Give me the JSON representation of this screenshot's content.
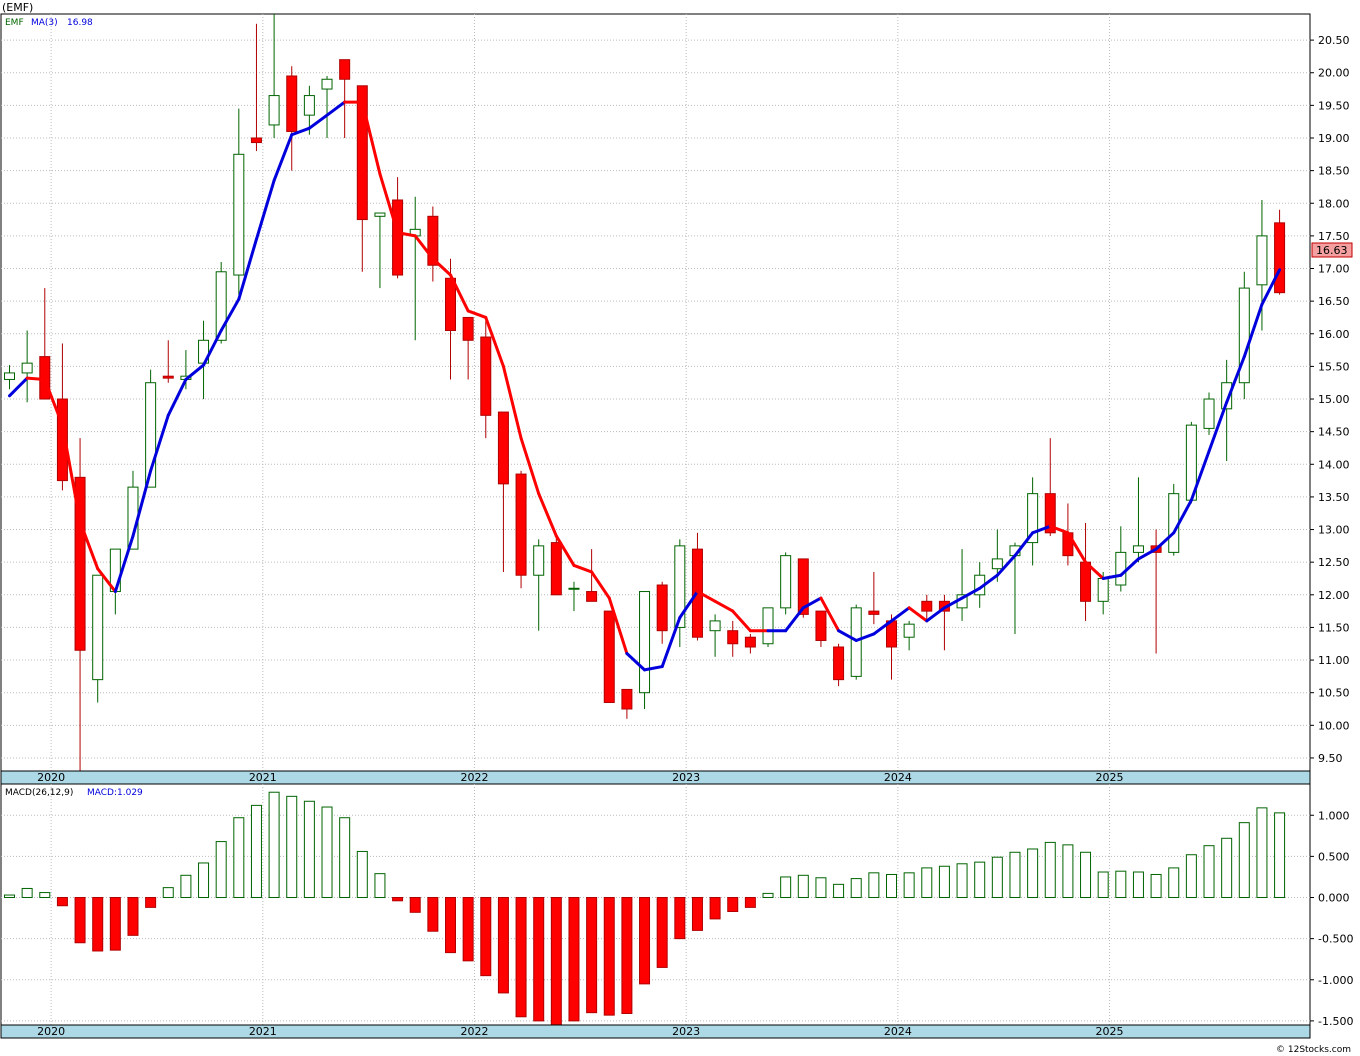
{
  "header": {
    "symbol": "(EMF)",
    "copyright": "© 12Stocks.com"
  },
  "price_legend": {
    "ticker": "EMF",
    "ma_label": "MA(3)",
    "ma_value": "16.98",
    "last_price": "16.63"
  },
  "macd_legend": {
    "label": "MACD(26,12,9)",
    "value_label": "MACD:1.029"
  },
  "colors": {
    "up": "#ffffff",
    "up_border": "#006400",
    "down": "#ff0000",
    "down_border": "#b00000",
    "ma_up": "#0000dd",
    "ma_down": "#ff0000",
    "axis_band": "#add8e6",
    "grid": "#bbbbbb"
  },
  "chart_data": [
    {
      "type": "candlestick",
      "title": "(EMF)",
      "interval": "monthly",
      "ylim": [
        9.3,
        20.9
      ],
      "y_ticks": [
        "9.50",
        "10.00",
        "10.50",
        "11.00",
        "11.50",
        "12.00",
        "12.50",
        "13.00",
        "13.50",
        "14.00",
        "14.50",
        "15.00",
        "15.50",
        "16.00",
        "16.50",
        "17.00",
        "17.50",
        "18.00",
        "18.50",
        "19.00",
        "19.50",
        "20.00",
        "20.50"
      ],
      "x_labels": [
        "2020",
        "2021",
        "2022",
        "2023",
        "2024",
        "2025"
      ],
      "x_label_index": [
        1,
        13,
        25,
        37,
        49,
        61
      ],
      "ohlc": [
        [
          15.3,
          15.52,
          15.15,
          15.4
        ],
        [
          15.4,
          16.05,
          14.95,
          15.55
        ],
        [
          15.65,
          16.7,
          15.0,
          15.0
        ],
        [
          15.0,
          15.85,
          13.6,
          13.75
        ],
        [
          13.8,
          14.4,
          9.05,
          11.15
        ],
        [
          10.7,
          12.3,
          10.35,
          12.3
        ],
        [
          12.05,
          12.7,
          11.7,
          12.7
        ],
        [
          12.7,
          13.9,
          12.7,
          13.65
        ],
        [
          13.65,
          15.45,
          13.65,
          15.25
        ],
        [
          15.35,
          15.9,
          15.25,
          15.32
        ],
        [
          15.3,
          15.75,
          15.15,
          15.35
        ],
        [
          15.55,
          16.2,
          15.0,
          15.9
        ],
        [
          15.9,
          17.1,
          15.85,
          16.95
        ],
        [
          16.9,
          19.45,
          16.6,
          18.75
        ],
        [
          19.0,
          20.75,
          18.8,
          18.93
        ],
        [
          19.2,
          20.9,
          19.0,
          19.65
        ],
        [
          19.95,
          20.1,
          18.5,
          19.1
        ],
        [
          19.35,
          19.8,
          19.05,
          19.65
        ],
        [
          19.75,
          19.95,
          19.0,
          19.9
        ],
        [
          20.2,
          20.2,
          19.0,
          19.9
        ],
        [
          19.8,
          19.8,
          16.95,
          17.75
        ],
        [
          17.8,
          17.8,
          16.7,
          17.85
        ],
        [
          18.05,
          18.4,
          16.85,
          16.9
        ],
        [
          17.5,
          18.1,
          15.9,
          17.6
        ],
        [
          17.8,
          17.95,
          16.8,
          17.05
        ],
        [
          16.85,
          17.15,
          15.3,
          16.05
        ],
        [
          16.25,
          16.25,
          15.3,
          15.9
        ],
        [
          15.95,
          16.2,
          14.4,
          14.75
        ],
        [
          14.8,
          14.8,
          12.35,
          13.7
        ],
        [
          13.85,
          13.9,
          12.1,
          12.3
        ],
        [
          12.3,
          12.85,
          11.45,
          12.75
        ],
        [
          12.8,
          12.9,
          12.0,
          12.0
        ],
        [
          12.1,
          12.2,
          11.75,
          12.1
        ],
        [
          12.05,
          12.7,
          11.9,
          11.9
        ],
        [
          11.75,
          11.75,
          10.35,
          10.35
        ],
        [
          10.55,
          10.55,
          10.1,
          10.25
        ],
        [
          10.5,
          12.05,
          10.25,
          12.05
        ],
        [
          12.15,
          12.2,
          11.25,
          11.45
        ],
        [
          11.5,
          12.85,
          11.2,
          12.75
        ],
        [
          12.7,
          12.95,
          11.3,
          11.35
        ],
        [
          11.45,
          11.7,
          11.05,
          11.6
        ],
        [
          11.45,
          11.6,
          11.05,
          11.25
        ],
        [
          11.35,
          11.4,
          11.1,
          11.2
        ],
        [
          11.25,
          11.8,
          11.2,
          11.8
        ],
        [
          11.8,
          12.65,
          11.7,
          12.6
        ],
        [
          12.55,
          12.55,
          11.65,
          11.7
        ],
        [
          11.75,
          11.75,
          11.2,
          11.3
        ],
        [
          11.2,
          11.25,
          10.6,
          10.7
        ],
        [
          10.75,
          11.85,
          10.7,
          11.8
        ],
        [
          11.75,
          12.35,
          11.55,
          11.7
        ],
        [
          11.6,
          11.7,
          10.7,
          11.2
        ],
        [
          11.35,
          11.6,
          11.15,
          11.55
        ],
        [
          11.9,
          12.0,
          11.6,
          11.75
        ],
        [
          11.9,
          12.0,
          11.15,
          11.75
        ],
        [
          11.8,
          12.7,
          11.6,
          12.0
        ],
        [
          12.0,
          12.5,
          11.8,
          12.3
        ],
        [
          12.4,
          13.0,
          12.2,
          12.55
        ],
        [
          12.6,
          12.8,
          11.4,
          12.75
        ],
        [
          12.8,
          13.8,
          12.45,
          13.55
        ],
        [
          13.55,
          14.4,
          12.9,
          12.95
        ],
        [
          12.95,
          13.4,
          12.45,
          12.6
        ],
        [
          12.5,
          13.1,
          11.6,
          11.9
        ],
        [
          11.9,
          12.35,
          11.7,
          12.25
        ],
        [
          12.15,
          13.05,
          12.05,
          12.65
        ],
        [
          12.65,
          13.8,
          12.5,
          12.75
        ],
        [
          12.75,
          13.0,
          11.1,
          12.65
        ],
        [
          12.65,
          13.7,
          12.6,
          13.55
        ],
        [
          13.45,
          14.65,
          13.4,
          14.6
        ],
        [
          14.55,
          15.1,
          14.45,
          15.0
        ],
        [
          14.85,
          15.6,
          14.05,
          15.25
        ],
        [
          15.25,
          16.95,
          15.0,
          16.7
        ],
        [
          16.75,
          18.05,
          16.05,
          17.5
        ],
        [
          17.7,
          17.9,
          16.6,
          16.63
        ]
      ],
      "ma3": [
        15.05,
        15.32,
        15.3,
        14.6,
        13.12,
        12.4,
        12.05,
        12.9,
        13.9,
        14.75,
        15.3,
        15.52,
        16.05,
        16.53,
        17.45,
        18.35,
        19.05,
        19.15,
        19.35,
        19.55,
        19.55,
        18.45,
        17.55,
        17.5,
        17.15,
        16.9,
        16.35,
        16.25,
        15.5,
        14.4,
        13.55,
        12.9,
        12.45,
        12.35,
        11.95,
        11.1,
        10.85,
        10.9,
        11.65,
        12.05,
        11.9,
        11.75,
        11.45,
        11.45,
        11.45,
        11.8,
        11.95,
        11.45,
        11.3,
        11.4,
        11.6,
        11.8,
        11.6,
        11.8,
        11.95,
        12.1,
        12.3,
        12.6,
        12.95,
        13.05,
        12.95,
        12.5,
        12.25,
        12.3,
        12.55,
        12.7,
        12.95,
        13.45,
        14.2,
        14.95,
        15.65,
        16.45,
        16.98
      ],
      "ma3_up": [
        true,
        true,
        false,
        false,
        false,
        false,
        false,
        true,
        true,
        true,
        true,
        true,
        true,
        true,
        true,
        true,
        true,
        true,
        true,
        true,
        false,
        false,
        false,
        false,
        false,
        false,
        false,
        false,
        false,
        false,
        false,
        false,
        false,
        false,
        false,
        false,
        true,
        true,
        true,
        true,
        false,
        false,
        false,
        false,
        true,
        true,
        true,
        false,
        true,
        true,
        true,
        true,
        false,
        true,
        true,
        true,
        true,
        true,
        true,
        true,
        false,
        false,
        false,
        true,
        true,
        true,
        true,
        true,
        true,
        true,
        true,
        true,
        true
      ]
    },
    {
      "type": "bar",
      "title": "MACD(26,12,9)",
      "ylim": [
        -1.55,
        1.38
      ],
      "y_ticks": [
        "-1.500",
        "-1.000",
        "-0.500",
        "0.000",
        "0.500",
        "1.000"
      ],
      "x_labels": [
        "2020",
        "2021",
        "2022",
        "2023",
        "2024",
        "2025"
      ],
      "values": [
        0.03,
        0.11,
        0.06,
        -0.1,
        -0.55,
        -0.65,
        -0.64,
        -0.46,
        -0.12,
        0.12,
        0.27,
        0.42,
        0.68,
        0.97,
        1.12,
        1.28,
        1.23,
        1.17,
        1.1,
        0.97,
        0.56,
        0.29,
        -0.04,
        -0.18,
        -0.41,
        -0.67,
        -0.77,
        -0.95,
        -1.16,
        -1.45,
        -1.5,
        -1.55,
        -1.5,
        -1.4,
        -1.43,
        -1.41,
        -1.05,
        -0.85,
        -0.5,
        -0.4,
        -0.26,
        -0.17,
        -0.12,
        0.05,
        0.25,
        0.27,
        0.24,
        0.16,
        0.23,
        0.3,
        0.28,
        0.3,
        0.36,
        0.38,
        0.41,
        0.43,
        0.49,
        0.55,
        0.59,
        0.67,
        0.64,
        0.55,
        0.31,
        0.32,
        0.31,
        0.28,
        0.36,
        0.52,
        0.63,
        0.72,
        0.91,
        1.09,
        1.029
      ]
    }
  ]
}
